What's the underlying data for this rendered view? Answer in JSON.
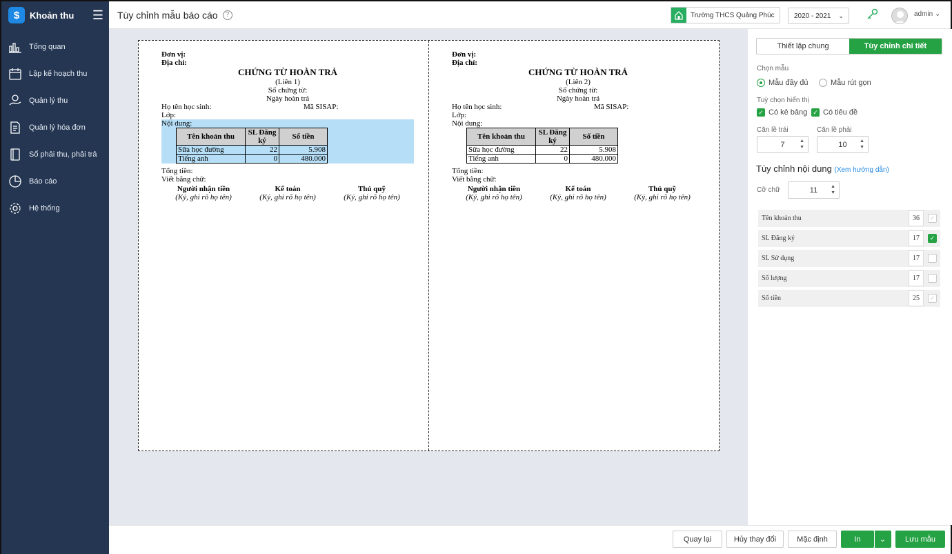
{
  "app": {
    "name": "Khoản thu",
    "logo_symbol": "$"
  },
  "sidebar": {
    "items": [
      {
        "label": "Tổng quan",
        "icon": "bar-chart-icon"
      },
      {
        "label": "Lập kế hoạch thu",
        "icon": "calendar-icon"
      },
      {
        "label": "Quản lý thu",
        "icon": "money-hand-icon"
      },
      {
        "label": "Quản lý hóa đơn",
        "icon": "invoice-icon"
      },
      {
        "label": "Sổ phải thu, phải trả",
        "icon": "ledger-icon"
      },
      {
        "label": "Báo cáo",
        "icon": "pie-chart-icon"
      },
      {
        "label": "Hệ thống",
        "icon": "gear-icon"
      }
    ]
  },
  "header": {
    "title": "Tùy chỉnh mẫu báo cáo",
    "help": "?",
    "school": "Trường THCS Quảng Phúc",
    "year": "2020 - 2021",
    "user": "admin"
  },
  "receipt": {
    "don_vi": "Đơn vị:",
    "dia_chi": "Địa chỉ:",
    "title": "CHỨNG TỪ HOÀN TRẢ",
    "copy1": "(Liên 1)",
    "copy2": "(Liên 2)",
    "so_chung_tu": "Số chứng từ:",
    "ngay": "Ngày hoàn trả",
    "ho_ten": "Họ tên học sinh:",
    "ma_sisap": "Mã SISAP:",
    "lop": "Lớp:",
    "noi_dung": "Nội dung:",
    "col1": "Tên khoản thu",
    "col2a": "SL Đăng",
    "col2b": "ký",
    "col3": "Số tiền",
    "rows": [
      {
        "name": "Sữa học đường",
        "qty": "22",
        "amount": "5.908"
      },
      {
        "name": "Tiếng anh",
        "qty": "0",
        "amount": "480.000"
      }
    ],
    "tong_tien": "Tổng tiền:",
    "viet_bang_chu": "Viết bằng chữ:",
    "sig1": "Người nhận tiền",
    "sig2": "Kế toán",
    "sig3": "Thủ quỹ",
    "sig_note": "(Ký, ghi rõ họ tên)"
  },
  "panel": {
    "tab1": "Thiết lập chung",
    "tab2": "Tùy chỉnh chi tiết",
    "chon_mau": "Chọn mẫu",
    "mau_day_du": "Mẫu đầy đủ",
    "mau_rut_gon": "Mẫu rút gọn",
    "tuy_chon": "Tuỳ chọn hiển thị",
    "co_ke_bang": "Có kẻ bảng",
    "co_tieu_de": "Có tiêu đề",
    "can_le_trai": "Căn lề trái",
    "can_le_phai": "Căn lề phải",
    "le_trai": "7",
    "le_phai": "10",
    "noi_dung_title": "Tùy chỉnh nội dung",
    "xem_huong_dan": "(Xem hướng dẫn)",
    "co_chu": "Cỡ chữ",
    "co_chu_val": "11",
    "fields": [
      {
        "label": "Tên khoản thu",
        "width": "36",
        "checked": true,
        "disabled": true
      },
      {
        "label": "SL Đăng ký",
        "width": "17",
        "checked": true,
        "disabled": false
      },
      {
        "label": "SL Sử dụng",
        "width": "17",
        "checked": false,
        "disabled": false
      },
      {
        "label": "Số lượng",
        "width": "17",
        "checked": false,
        "disabled": false
      },
      {
        "label": "Số tiền",
        "width": "25",
        "checked": true,
        "disabled": true
      }
    ]
  },
  "footer": {
    "back": "Quay lại",
    "cancel": "Hủy thay đổi",
    "default": "Mặc định",
    "print": "In",
    "save": "Lưu mẫu"
  }
}
